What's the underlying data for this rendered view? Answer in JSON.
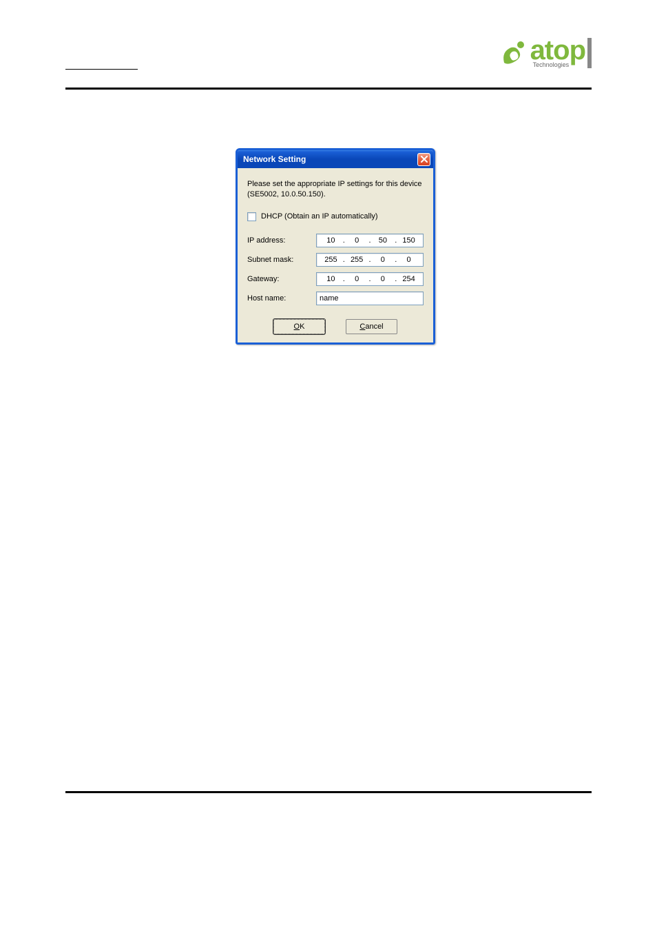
{
  "logo": {
    "brand": "atop",
    "tagline": "Technologies"
  },
  "dialog": {
    "title": "Network Setting",
    "instruction": "Please set the appropriate IP settings for this device (SE5002, 10.0.50.150).",
    "dhcp_label": "DHCP (Obtain an IP automatically)",
    "fields": {
      "ip_label": "IP address:",
      "ip_value": [
        "10",
        "0",
        "50",
        "150"
      ],
      "subnet_label": "Subnet mask:",
      "subnet_value": [
        "255",
        "255",
        "0",
        "0"
      ],
      "gateway_label": "Gateway:",
      "gateway_value": [
        "10",
        "0",
        "0",
        "254"
      ],
      "hostname_label": "Host name:",
      "hostname_value": "name"
    },
    "buttons": {
      "ok": "OK",
      "cancel": "Cancel"
    }
  }
}
